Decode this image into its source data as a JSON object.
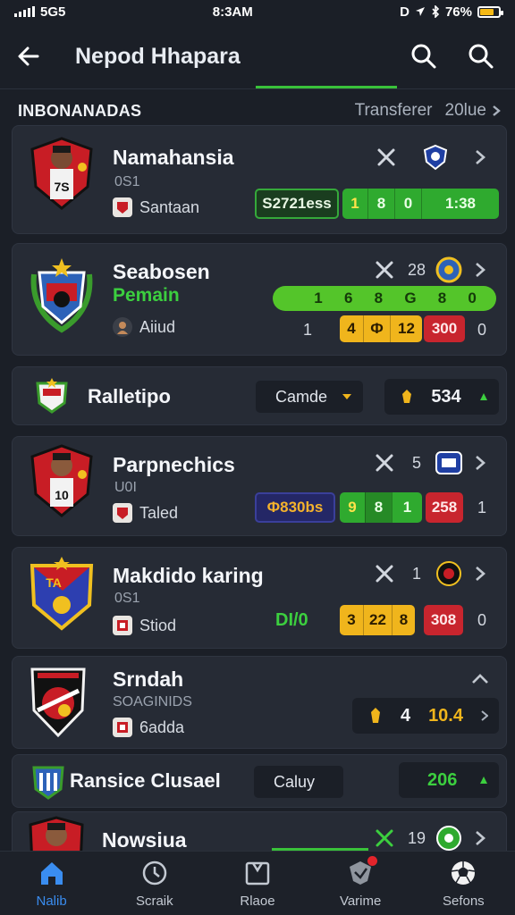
{
  "status": {
    "carrier": "5G5",
    "time": "8:3AM",
    "indicators": "D",
    "battery": "76%",
    "battery_color": "#f5b915"
  },
  "header": {
    "title": "Nepod Hhapara",
    "back_icon": "arrow-left-icon",
    "search_icons": [
      "search-icon",
      "search-icon"
    ],
    "accent": "#39c23a"
  },
  "section": {
    "title": "INBONANADAS",
    "link": "Transferer",
    "value": "20lue"
  },
  "cards": [
    {
      "name": "Namahansia",
      "sub": "0S1",
      "club": "Santaan",
      "tools_count": "",
      "pills": [
        "S2721ess",
        "1",
        "8",
        "0",
        "1:38"
      ]
    },
    {
      "name": "Seabosen",
      "role": "Pemain",
      "club": "Aiiud",
      "tools_count": "28",
      "row1": [
        "",
        "1",
        "6",
        "8",
        "G",
        "8",
        "0"
      ],
      "row2_left": "1",
      "row2": [
        "4",
        "Ф",
        "12",
        "300"
      ],
      "row2_right": "0"
    },
    {
      "name": "Parpnechics",
      "sub": "U0I",
      "club": "Taled",
      "tools_count": "5",
      "pill_navy": "Ф830bs",
      "pills": [
        "9",
        "8",
        "1"
      ],
      "red": "258",
      "right_num": "1"
    },
    {
      "name": "Makdido karing",
      "sub": "0S1",
      "club": "Stiod",
      "tools_count": "1",
      "green_text": "DI/0",
      "pills": [
        "3",
        "22",
        "8"
      ],
      "red": "308",
      "right_num": "0"
    },
    {
      "name": "Srndah",
      "sub": "SOAGINIDS",
      "club": "6adda",
      "stat_left": "4",
      "stat": "10.4"
    },
    {
      "name": "Nowsiua",
      "tools_count": "19"
    }
  ],
  "rows": [
    {
      "name": "Ralletipo",
      "dropdown": "Camde",
      "stat": "534"
    },
    {
      "name": "Ransice Clusael",
      "dropdown": "Caluy",
      "stat": "206"
    }
  ],
  "tabs": [
    {
      "label": "Nalib",
      "icon": "home-icon",
      "active": true
    },
    {
      "label": "Scraik",
      "icon": "clock-icon",
      "active": false
    },
    {
      "label": "Rlaoe",
      "icon": "board-icon",
      "active": false
    },
    {
      "label": "Varime",
      "icon": "shield-icon",
      "active": false,
      "badge": true
    },
    {
      "label": "Sefons",
      "icon": "ball-icon",
      "active": false
    }
  ]
}
